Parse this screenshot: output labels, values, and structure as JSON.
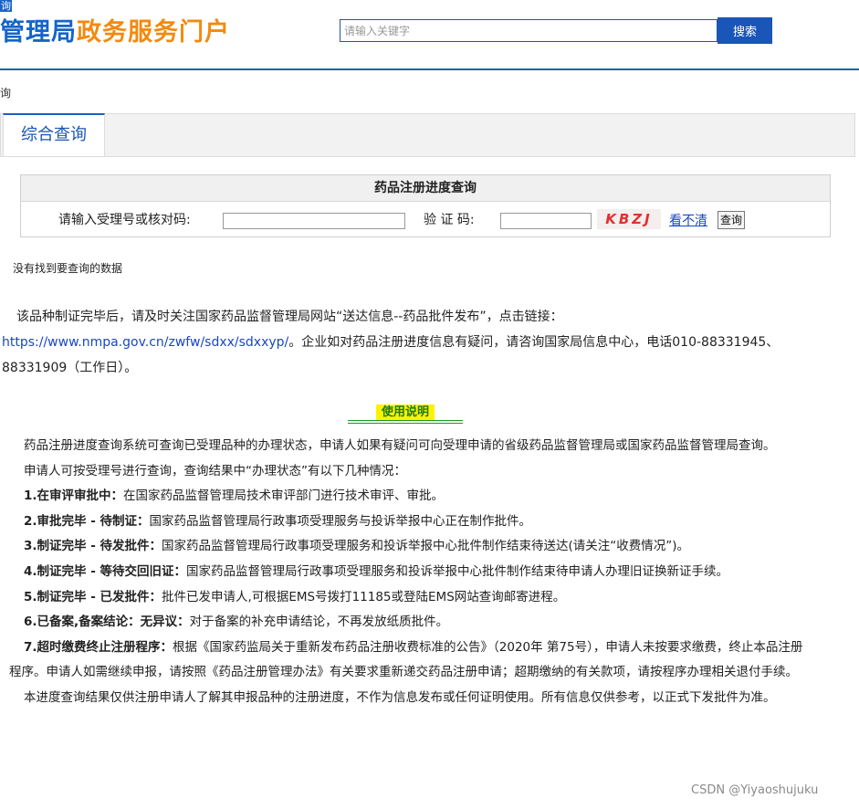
{
  "header": {
    "corner_tag": "询",
    "logo_part1": "管理局",
    "logo_part2": "政务服务门户",
    "search_placeholder": "请输入关键字",
    "search_button": "搜索"
  },
  "breadcrumb": "询",
  "tabs": [
    {
      "label": "综合查询"
    }
  ],
  "query": {
    "title": "药品注册进度查询",
    "acceptance_label": "请输入受理号或核对码:",
    "captcha_label": "验 证 码:",
    "captcha_value": "KBZJ",
    "refresh_link": "看不清",
    "submit_button": "查询"
  },
  "result_message": "没有找到要查询的数据",
  "notice": {
    "text_before": "该品种制证完毕后，请及时关注国家药品监督管理局网站“送达信息--药品批件发布”，点击链接：",
    "link": "https://www.nmpa.gov.cn/zwfw/sdxx/sdxxyp/",
    "text_after": "。企业如对药品注册进度信息有疑问，请咨询国家局信息中心，电话010-88331945、88331909（工作日）。"
  },
  "usage": {
    "title": "使用说明",
    "intro": "药品注册进度查询系统可查询已受理品种的办理状态，申请人如果有疑问可向受理申请的省级药品监督管理局或国家药品监督管理局查询。",
    "lead": "申请人可按受理号进行查询，查询结果中“办理状态”有以下几种情况：",
    "items": [
      {
        "title": "1.在审评审批中：",
        "text": "在国家药品监督管理局技术审评部门进行技术审评、审批。"
      },
      {
        "title": "2.审批完毕 - 待制证：",
        "text": "国家药品监督管理局行政事项受理服务与投诉举报中心正在制作批件。"
      },
      {
        "title": "3.制证完毕 - 待发批件：",
        "text": "国家药品监督管理局行政事项受理服务和投诉举报中心批件制作结束待送达(请关注“收费情况”)。"
      },
      {
        "title": "4.制证完毕 - 等待交回旧证：",
        "text": "国家药品监督管理局行政事项受理服务和投诉举报中心批件制作结束待申请人办理旧证换新证手续。"
      },
      {
        "title": "5.制证完毕 - 已发批件：",
        "text": "批件已发申请人,可根据EMS号拨打11185或登陆EMS网站查询邮寄进程。"
      },
      {
        "title": "6.已备案,备案结论：无异议：",
        "text": "对于备案的补充申请结论，不再发放纸质批件。"
      },
      {
        "title": "7.超时缴费终止注册程序：",
        "text": "根据《国家药监局关于重新发布药品注册收费标准的公告》（2020年 第75号），申请人未按要求缴费，终止本品注册程序。申请人如需继续申报，请按照《药品注册管理办法》有关要求重新递交药品注册申请；超期缴纳的有关款项，请按程序办理相关退付手续。"
      }
    ],
    "closing": "本进度查询结果仅供注册申请人了解其申报品种的注册进度，不作为信息发布或任何证明使用。所有信息仅供参考，以正式下发批件为准。"
  },
  "watermark": "CSDN @Yiyaoshujuku"
}
